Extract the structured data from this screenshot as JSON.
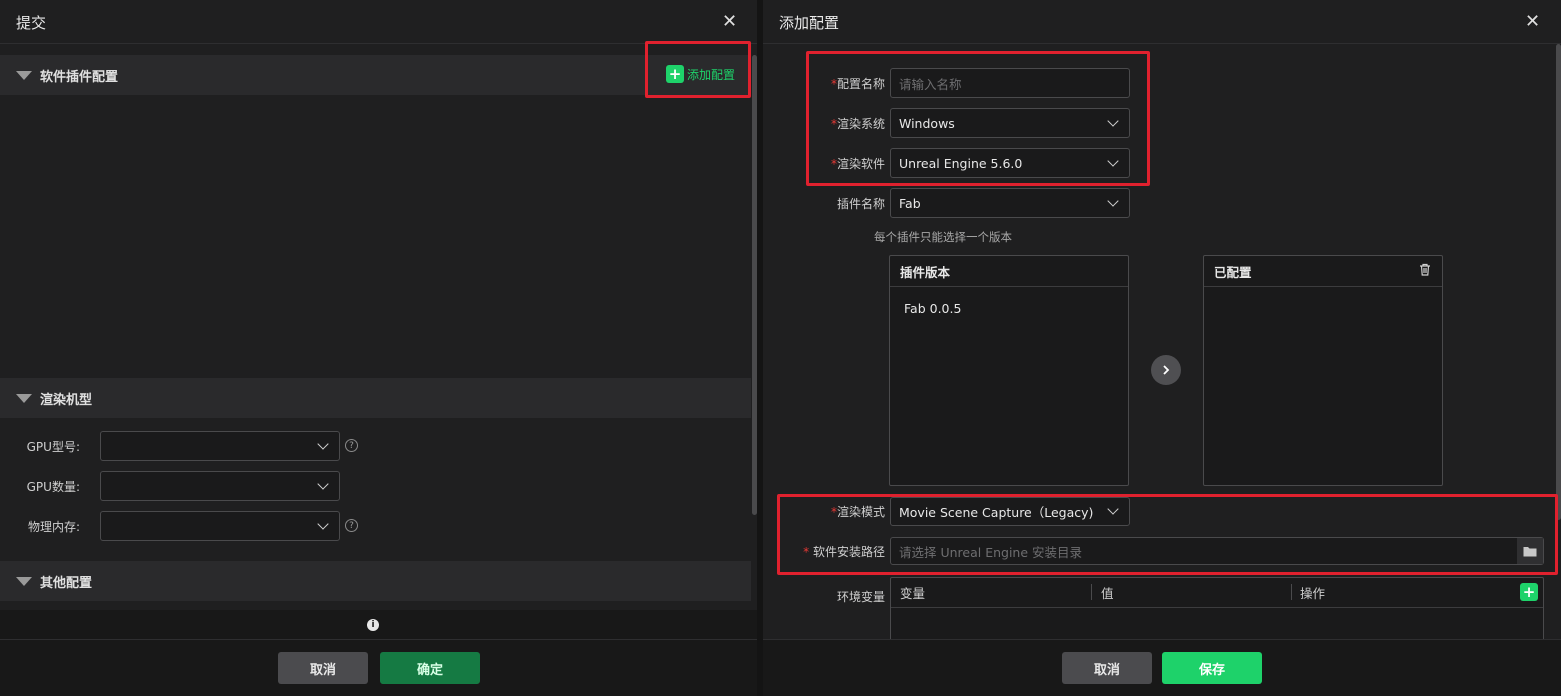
{
  "left": {
    "title": "提交",
    "add_config_label": "添加配置",
    "plugin_section": "软件插件配置",
    "render_section": "渲染机型",
    "gpu_model_label": "GPU型号:",
    "gpu_count_label": "GPU数量:",
    "memory_label": "物理内存:",
    "other_section": "其他配置",
    "help_glyph": "?",
    "info_glyph": "i",
    "cancel_label": "取消",
    "confirm_label": "确定"
  },
  "right": {
    "title": "添加配置",
    "required_mark": "*",
    "config_name_label": "配置名称",
    "config_name_placeholder": "请输入名称",
    "render_system_label": "渲染系统",
    "render_system_value": "Windows",
    "render_software_label": "渲染软件",
    "render_software_value": "Unreal Engine 5.6.0",
    "plugin_name_label": "插件名称",
    "plugin_name_value": "Fab",
    "plugin_hint": "每个插件只能选择一个版本",
    "version_panel_title": "插件版本",
    "versions": [
      "Fab 0.0.5"
    ],
    "configured_panel_title": "已配置",
    "render_mode_label": "渲染模式",
    "render_mode_value": "Movie Scene Capture（Legacy)",
    "install_path_label": "软件安装路径",
    "install_path_placeholder": "请选择 Unreal Engine 安装目录",
    "env_label": "环境变量",
    "env_columns": [
      "变量",
      "值",
      "操作"
    ],
    "cancel_label": "取消",
    "save_label": "保存"
  },
  "colors": {
    "highlight_red": "#e0212e",
    "green_accent": "#1ed26a",
    "confirm_green": "#157a43"
  },
  "icons": [
    "close-icon",
    "plus-icon",
    "chevron-down-icon",
    "help-icon",
    "info-icon",
    "trash-icon",
    "arrow-right-icon",
    "folder-icon"
  ]
}
